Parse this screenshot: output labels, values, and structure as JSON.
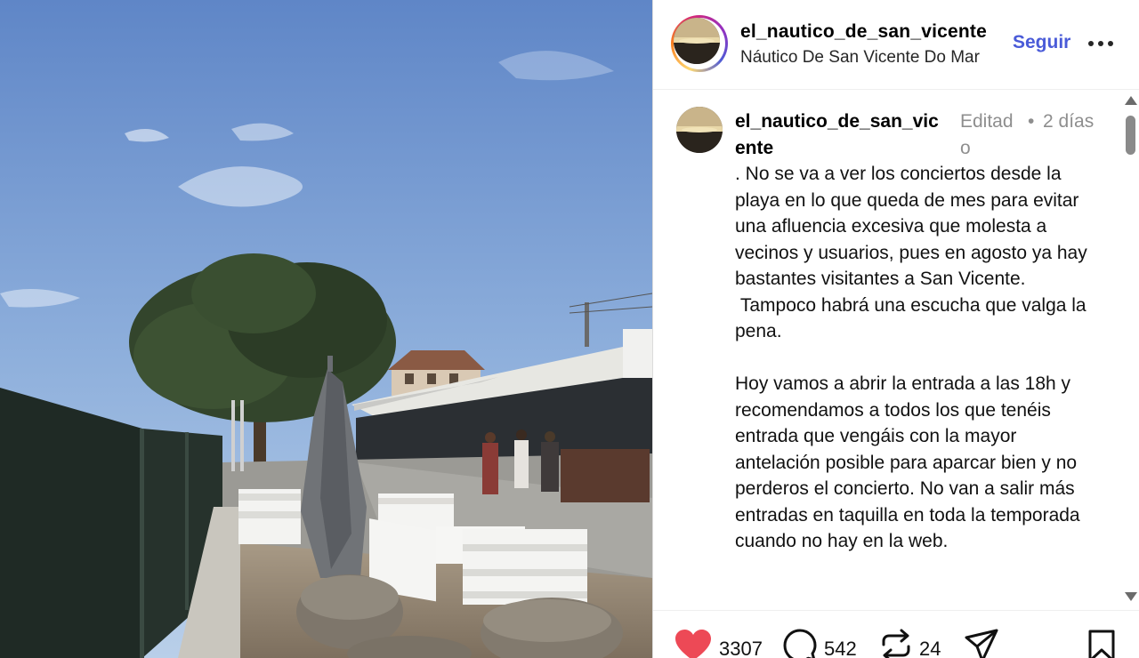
{
  "post": {
    "username": "el_nautico_de_san_vicente",
    "location": "Náutico De San Vicente Do Mar",
    "follow_label": "Seguir",
    "more_icon": "more-horizontal-icon"
  },
  "caption": {
    "username": "el_nautico_de_san_vicente",
    "edited_label": "Editado",
    "separator": "•",
    "time_label": "2 días",
    "text": ". No se va a ver los conciertos desde la playa en lo que queda de mes para evitar una afluencia excesiva que molesta a vecinos y usuarios, pues en agosto ya hay bastantes visitantes a San Vicente.\n Tampoco habrá una escucha que valga la pena.\n\nHoy vamos a abrir la entrada a las 18h y recomendamos a todos los que tenéis entrada que vengáis con la mayor antelación posible para aparcar bien y no perderos el concierto. No van a salir más entradas en taquilla en toda la temporada cuando no hay en la web."
  },
  "actions": {
    "likes": "3307",
    "comments": "542",
    "reposts": "24",
    "like_icon": "heart-filled-icon",
    "comment_icon": "comment-icon",
    "repost_icon": "repost-icon",
    "share_icon": "share-icon",
    "save_icon": "bookmark-icon"
  },
  "colors": {
    "accent": "#4a5bd8",
    "like": "#ed4956",
    "muted": "#8e8e8e"
  }
}
